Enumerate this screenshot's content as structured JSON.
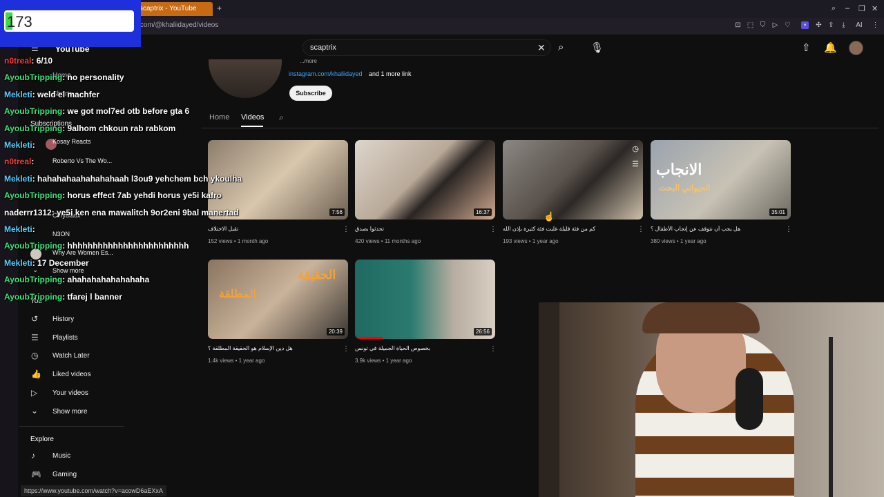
{
  "browser": {
    "tab_title": "scaptrix - YouTube",
    "new_tab": "+",
    "url": ".com/@khaliidayed/videos",
    "extension_label": "AI",
    "status_url": "https://www.youtube.com/watch?v=acowD6aEXxA"
  },
  "youtube": {
    "logo": "YouTube",
    "search_value": "scaptrix",
    "channel": {
      "more_text": "...more",
      "link": "instagram.com/khaliidayed",
      "link_more": "and 1 more link",
      "subscribe": "Subscribe"
    },
    "tabs": {
      "home": "Home",
      "videos": "Videos"
    },
    "videos": [
      {
        "title": "تقبل الاختلاف",
        "meta": "152 views • 1 month ago",
        "duration": "7:56"
      },
      {
        "title": "تحدثوا بصدق",
        "meta": "420 views • 11 months ago",
        "duration": "16:37"
      },
      {
        "title": "كم من فئة قليلة غلبت فئة كثيرة بإذن الله",
        "meta": "193 views • 1 year ago",
        "duration": ""
      },
      {
        "title": "هل يجب أن نتوقف عن إنجاب الأطفال ؟",
        "meta": "380 views • 1 year ago",
        "duration": "35:01",
        "thumb_line1": "الانجاب",
        "thumb_line2": "الحيواني البحت"
      },
      {
        "title": "هل دين الإسلام هو الحقيقة المطلقة ؟",
        "meta": "1.4k views • 1 year ago",
        "duration": "20:39",
        "thumb_line1": "الحقيقة",
        "thumb_line2": "المطلقة"
      },
      {
        "title": "بخصوص الحياة الجميلة في تونس",
        "meta": "3.9k views • 1 year ago",
        "duration": "26:56"
      }
    ],
    "sidebar": {
      "home": "Home",
      "shorts": "Shorts",
      "subscriptions": "Subscriptions",
      "subs": [
        "Kosay Reacts",
        "Roberto Vs The Wo...",
        "...",
        "Cerydiaux",
        "N3ON",
        "Why Are Women Es..."
      ],
      "show_more_1": "Show more",
      "you": "You",
      "you_items": [
        "History",
        "Playlists",
        "Watch Later",
        "Liked videos",
        "Your videos",
        "Show more"
      ],
      "explore": "Explore",
      "explore_items": [
        "Music",
        "Gaming"
      ]
    }
  },
  "overlay": {
    "counter": "173",
    "chat": [
      {
        "user": "n0treal",
        "msg": ": 6/10",
        "color": "#ff3b3b"
      },
      {
        "user": "AyoubTripping",
        "msg": ": no personality",
        "color": "#3ee07a"
      },
      {
        "user": "Mekleti",
        "msg": ": weld el machfer",
        "color": "#5ad0ff"
      },
      {
        "user": "AyoubTripping",
        "msg": ": we got mol7ed otb before gta 6",
        "color": "#3ee07a"
      },
      {
        "user": "AyoubTripping",
        "msg": ": 9alhom chkoun rab rabkom",
        "color": "#3ee07a"
      },
      {
        "user": "Mekleti",
        "msg": ":",
        "color": "#5ad0ff"
      },
      {
        "user": "n0treal",
        "msg": ":",
        "color": "#ff3b3b"
      },
      {
        "user": "Mekleti",
        "msg": ": hahahahaahahahahaah l3ou9 yehchem bch ykoulha",
        "color": "#5ad0ff"
      },
      {
        "user": "AyoubTripping",
        "msg": ": horus effect 7ab yehdi horus ye5i kafro",
        "color": "#3ee07a"
      },
      {
        "user": "naderrr1312",
        "msg": ": ye5i ken ena mawalitch 9or2eni 9bal manertad",
        "color": "#ffffff"
      },
      {
        "user": "Mekleti",
        "msg": ":",
        "color": "#5ad0ff"
      },
      {
        "user": "AyoubTripping",
        "msg": ": hhhhhhhhhhhhhhhhhhhhhhhh",
        "color": "#3ee07a"
      },
      {
        "user": "Mekleti",
        "msg": ": 17 December",
        "color": "#5ad0ff"
      },
      {
        "user": "AyoubTripping",
        "msg": ": ahahahahahahahaha",
        "color": "#3ee07a"
      },
      {
        "user": "AyoubTripping",
        "msg": ": tfarej l banner",
        "color": "#3ee07a"
      }
    ]
  }
}
